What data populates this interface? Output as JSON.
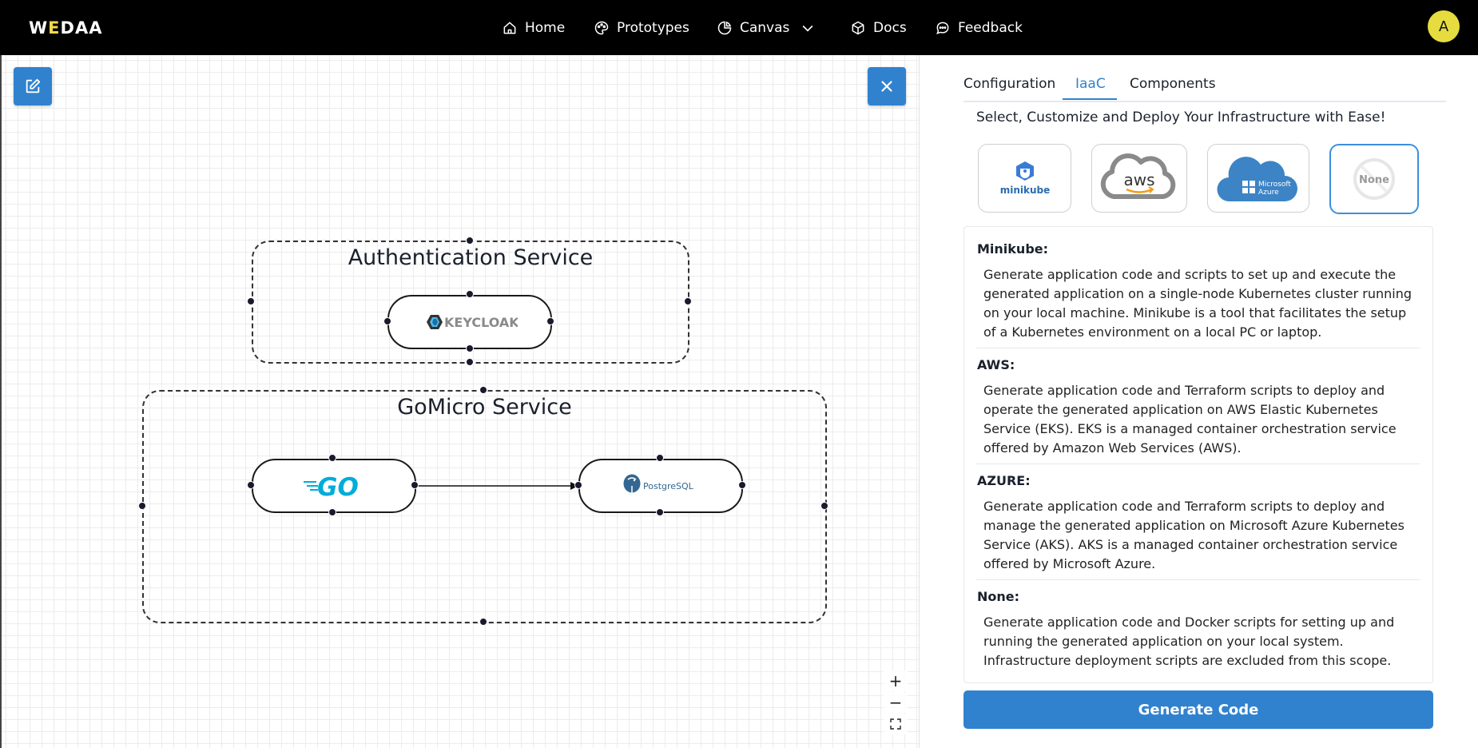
{
  "header": {
    "logo": {
      "part1": "W",
      "accent": "E",
      "part2": "DAA"
    },
    "nav": [
      {
        "label": "Home",
        "icon": "home-icon"
      },
      {
        "label": "Prototypes",
        "icon": "palette-icon"
      },
      {
        "label": "Canvas",
        "icon": "pie-chart-icon"
      },
      {
        "label": "Docs",
        "icon": "box-icon"
      },
      {
        "label": "Feedback",
        "icon": "message-icon"
      }
    ],
    "avatar_initial": "A"
  },
  "canvas": {
    "groups": [
      {
        "title": "Authentication Service",
        "nodes": [
          {
            "logo": "KEYCLOAK"
          }
        ]
      },
      {
        "title": "GoMicro Service",
        "nodes": [
          {
            "logo": "GO"
          },
          {
            "logo": "PostgreSQL"
          }
        ]
      }
    ],
    "zoom_controls": {
      "in": "+",
      "out": "−"
    }
  },
  "panel": {
    "tabs": [
      "Configuration",
      "IaaC",
      "Components"
    ],
    "active_tab": "IaaC",
    "intro": "Select, Customize and Deploy Your Infrastructure with Ease!",
    "providers": [
      {
        "name": "minikube",
        "selected": false
      },
      {
        "name": "aws",
        "selected": false
      },
      {
        "name": "Microsoft Azure",
        "label_line1": "Microsoft",
        "label_line2": "Azure",
        "selected": false
      },
      {
        "name": "None",
        "selected": true
      }
    ],
    "descriptions": [
      {
        "title": "Minikube:",
        "text": "Generate application code and scripts to set up and execute the generated application on a single-node Kubernetes cluster running on your local machine. Minikube is a tool that facilitates the setup of a Kubernetes environment on a local PC or laptop."
      },
      {
        "title": "AWS:",
        "text": "Generate application code and Terraform scripts to deploy and operate the generated application on AWS Elastic Kubernetes Service (EKS). EKS is a managed container orchestration service offered by Amazon Web Services (AWS)."
      },
      {
        "title": "AZURE:",
        "text": "Generate application code and Terraform scripts to deploy and manage the generated application on Microsoft Azure Kubernetes Service (AKS). AKS is a managed container orchestration service offered by Microsoft Azure."
      },
      {
        "title": "None:",
        "text": "Generate application code and Docker scripts for setting up and running the generated application on your local system. Infrastructure deployment scripts are excluded from this scope."
      }
    ],
    "generate_label": "Generate Code"
  },
  "colors": {
    "primary": "#3182ce",
    "header_bg": "#000000",
    "avatar_bg": "#e6dc3f",
    "go_blue": "#00add8",
    "postgres_blue": "#336791",
    "azure_blue": "#3c84c5"
  }
}
